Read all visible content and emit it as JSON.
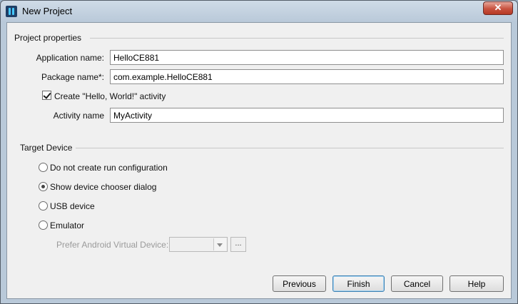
{
  "window": {
    "title": "New Project"
  },
  "project_properties": {
    "section_title": "Project properties",
    "application_name_label": "Application name:",
    "application_name_value": "HelloCE881",
    "package_name_label": "Package name*:",
    "package_name_value": "com.example.HelloCE881",
    "create_activity_label": "Create \"Hello, World!\" activity",
    "create_activity_checked": true,
    "activity_name_label": "Activity name",
    "activity_name_value": "MyActivity"
  },
  "target_device": {
    "section_title": "Target Device",
    "options": [
      {
        "label": "Do not create run configuration",
        "selected": false
      },
      {
        "label": "Show device chooser dialog",
        "selected": true
      },
      {
        "label": "USB device",
        "selected": false
      },
      {
        "label": "Emulator",
        "selected": false
      }
    ],
    "prefer_avd_label": "Prefer Android Virtual Device:",
    "browse_label": "..."
  },
  "buttons": {
    "previous": "Previous",
    "finish": "Finish",
    "cancel": "Cancel",
    "help": "Help"
  },
  "icons": {
    "app_icon": "intellij-idea-icon",
    "close": "close-icon"
  }
}
